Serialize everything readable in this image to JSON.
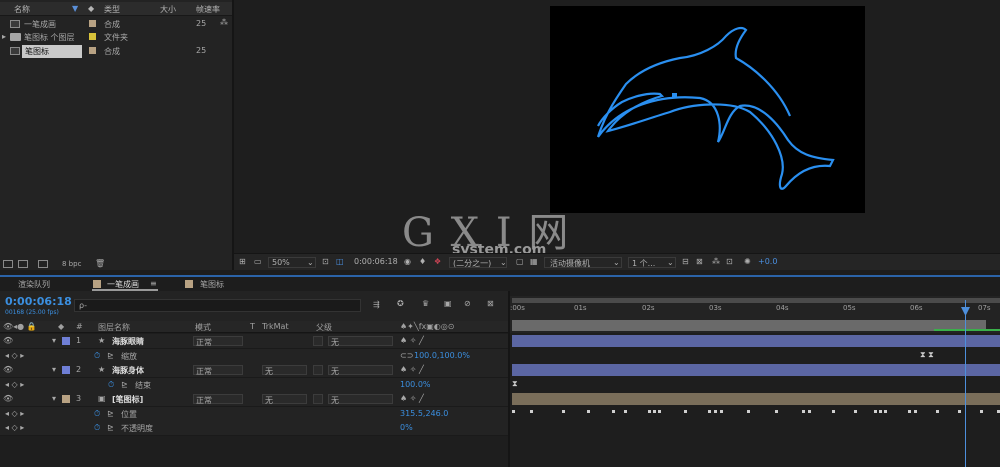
{
  "project": {
    "headers": {
      "name": "名称",
      "type": "类型",
      "size": "大小",
      "fps": "帧速率"
    },
    "items": [
      {
        "name": "一笔成画",
        "type": "合成",
        "fps": "25"
      },
      {
        "name": "笔图标 个图层",
        "type": "文件夹",
        "fps": ""
      },
      {
        "name": "笔图标",
        "type": "合成",
        "fps": "25"
      }
    ],
    "bpc": "8 bpc"
  },
  "viewer": {
    "zoom": "50%",
    "timecode": "0:00:06:18",
    "resolution": "(二分之一)",
    "camera": "活动摄像机",
    "views": "1 个...",
    "exposure": "+0.0"
  },
  "timeline": {
    "tab_render": "渲染队列",
    "tab_comp1": "一笔成画",
    "tab_comp2": "笔图标",
    "current_time": "0:00:06:18",
    "frame_info": "00168 (25.00 fps)",
    "search_placeholder": "ρ-",
    "columns": {
      "num": "#",
      "layer_name": "图层名称",
      "mode": "模式",
      "t": "T",
      "trkmat": "TrkMat",
      "parent": "父级"
    },
    "ruler": [
      ":00s",
      "01s",
      "02s",
      "03s",
      "04s",
      "05s",
      "06s",
      "07s"
    ],
    "layers": [
      {
        "num": "1",
        "name": "海豚眼睛",
        "mode": "正常",
        "trkmat": "",
        "parent": "无",
        "prop": "缩放",
        "value": "100.0,100.0%",
        "color": "#6f7fd6"
      },
      {
        "num": "2",
        "name": "海豚身体",
        "mode": "正常",
        "trkmat": "无",
        "parent": "无",
        "prop": "结束",
        "value": "100.0%",
        "color": "#6f7fd6"
      },
      {
        "num": "3",
        "name": "[笔图标]",
        "mode": "正常",
        "trkmat": "无",
        "parent": "无",
        "prop": "位置",
        "value": "315.5,246.0",
        "prop2": "不透明度",
        "value2": "0%",
        "color": "#b8a283"
      }
    ]
  },
  "watermark": {
    "main": "G X I 网",
    "sub": "system.com"
  },
  "colors": {
    "accent": "#2b63a8",
    "stroke": "#1e90ff",
    "layer_blue": "#5b66a3",
    "layer_tan": "#7a6e5a"
  }
}
